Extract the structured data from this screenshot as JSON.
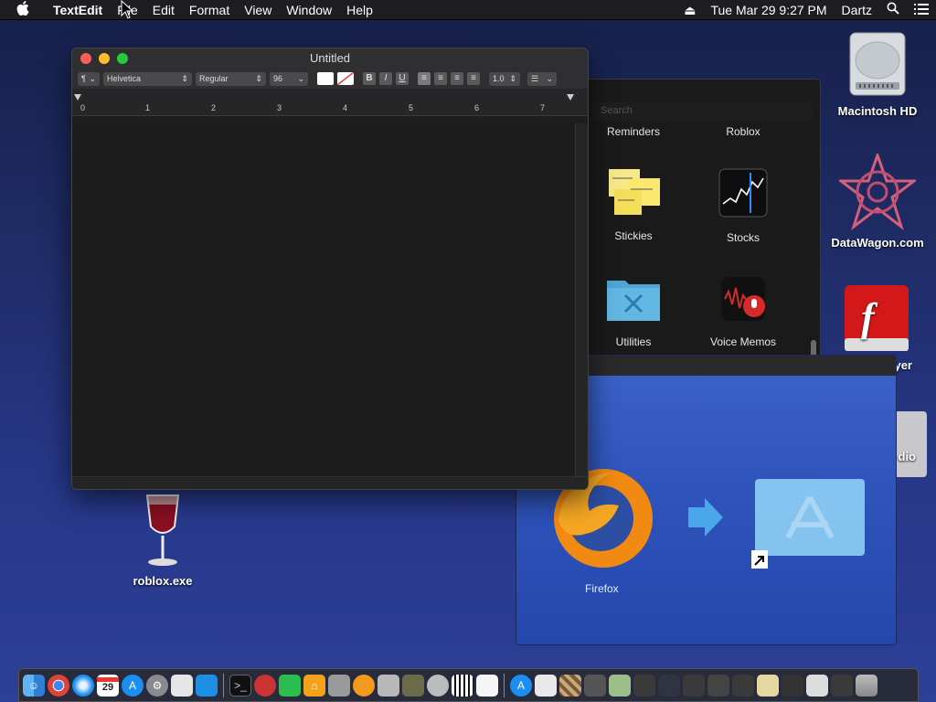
{
  "menubar": {
    "apple": "",
    "app": "TextEdit",
    "items": [
      "File",
      "Edit",
      "Format",
      "View",
      "Window",
      "Help"
    ],
    "eject": "⏏",
    "datetime": "Tue Mar 29  9:27 PM",
    "user": "Dartz"
  },
  "desktop": {
    "icons": [
      {
        "label": "Macintosh HD"
      },
      {
        "label": "DataWagon.com"
      },
      {
        "label": "yer"
      },
      {
        "label": "dio"
      },
      {
        "label": "roblox.exe"
      }
    ]
  },
  "launchpad": {
    "search_placeholder": "Search",
    "items": [
      "Reminders",
      "Roblox",
      "Stickies",
      "Stocks",
      "Utilities",
      "Voice Memos"
    ]
  },
  "installer": {
    "app_label": "Firefox"
  },
  "textedit": {
    "title": "Untitled",
    "paragraph_style": "¶",
    "font_family": "Helvetica",
    "font_style": "Regular",
    "font_size": "96",
    "bold": "B",
    "italic": "I",
    "underline": "U",
    "line_spacing": "1.0",
    "ruler_numbers": [
      "0",
      "1",
      "2",
      "3",
      "4",
      "5",
      "6",
      "7"
    ]
  },
  "dock": {
    "calendar_day": "29"
  }
}
